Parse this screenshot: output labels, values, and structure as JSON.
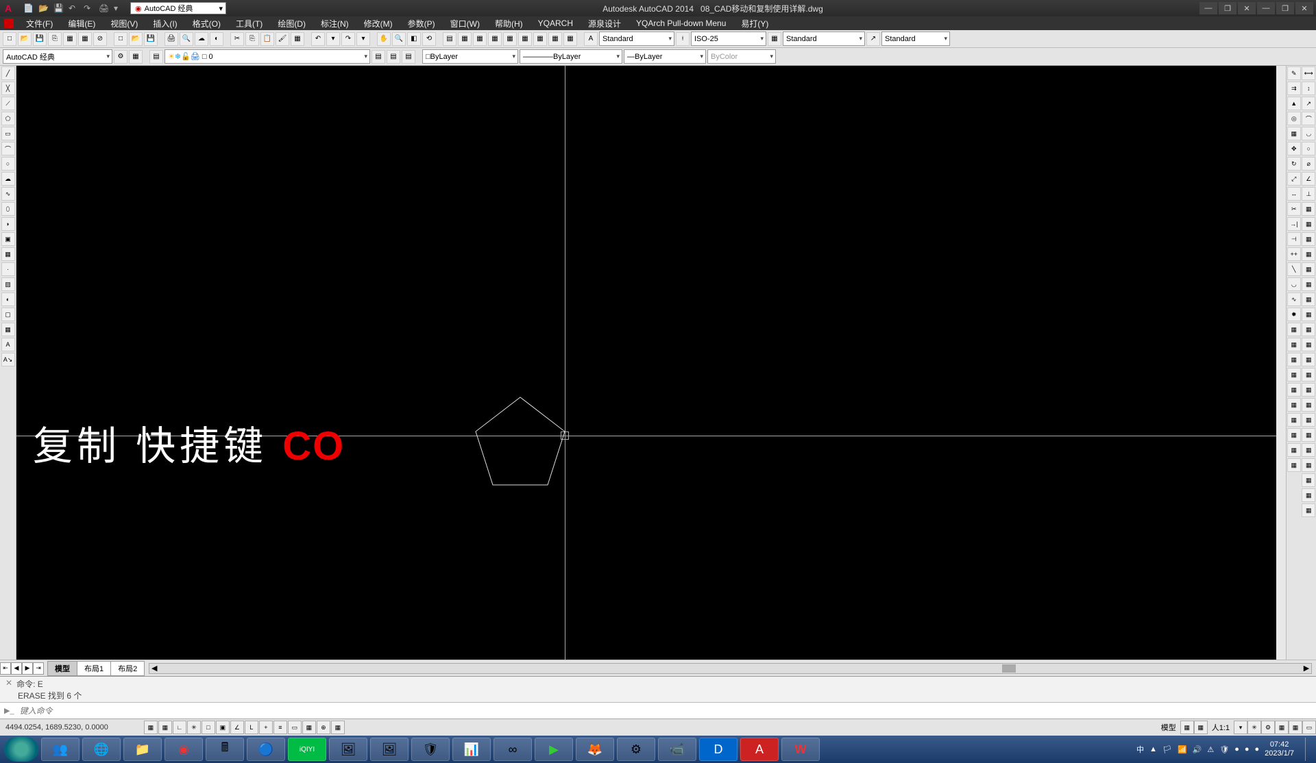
{
  "app": {
    "name": "Autodesk AutoCAD 2014",
    "file": "08_CAD移动和复制使用详解.dwg"
  },
  "qat_workspace": "AutoCAD 经典",
  "menu": [
    "文件(F)",
    "编辑(E)",
    "视图(V)",
    "插入(I)",
    "格式(O)",
    "工具(T)",
    "绘图(D)",
    "标注(N)",
    "修改(M)",
    "参数(P)",
    "窗口(W)",
    "帮助(H)",
    "YQARCH",
    "源泉设计",
    "YQArch Pull-down Menu",
    "易打(Y)"
  ],
  "styles": {
    "text": "Standard",
    "dim": "ISO-25",
    "table": "Standard",
    "mleader": "Standard"
  },
  "workspace_sel": "AutoCAD 经典",
  "layer_sel": "0",
  "linecolor": "ByLayer",
  "linetype": "ByLayer",
  "lineweight": "ByLayer",
  "plotstyle": "ByColor",
  "canvas_text": {
    "prefix": "复制  快捷键 ",
    "red": "CO"
  },
  "tabs": {
    "model": "模型",
    "l1": "布局1",
    "l2": "布局2"
  },
  "cmd": {
    "l1": "命令: E",
    "l2": "ERASE 找到 6 个",
    "placeholder": "键入命令"
  },
  "status": {
    "coords": "4494.0254, 1689.5230, 0.0000",
    "model": "模型",
    "scale": "人1:1",
    "ime": "中"
  },
  "clock": {
    "time": "07:42",
    "date": "2023/1/7"
  }
}
